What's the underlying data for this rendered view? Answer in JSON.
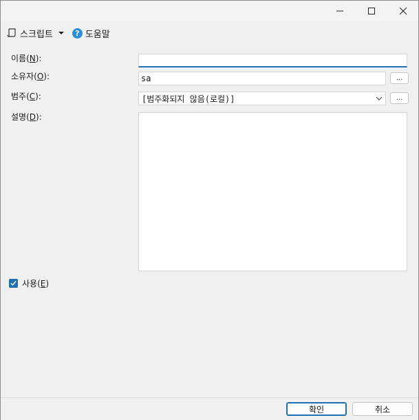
{
  "titlebar": {
    "minimize_icon": "minimize-icon",
    "maximize_icon": "maximize-icon",
    "close_icon": "close-icon"
  },
  "toolbar": {
    "script_label": "스크립트",
    "help_label": "도움말",
    "help_glyph": "?"
  },
  "form": {
    "name_label_pre": "이름(",
    "name_label_key": "N",
    "name_label_post": "):",
    "name_value": "",
    "owner_label_pre": "소유자(",
    "owner_label_key": "O",
    "owner_label_post": "):",
    "owner_value": "sa",
    "owner_browse": "...",
    "category_label_pre": "범주(",
    "category_label_key": "C",
    "category_label_post": "):",
    "category_value": "[범주화되지 않음(로컬)]",
    "category_browse": "...",
    "description_label_pre": "설명(",
    "description_label_key": "D",
    "description_label_post": "):",
    "description_value": "",
    "enabled_label_pre": "사용(",
    "enabled_label_key": "E",
    "enabled_label_post": ")",
    "enabled_checked": true
  },
  "buttons": {
    "ok": "확인",
    "cancel": "취소"
  },
  "colors": {
    "accent": "#1f6fb5",
    "help_icon": "#2a8fd8"
  }
}
